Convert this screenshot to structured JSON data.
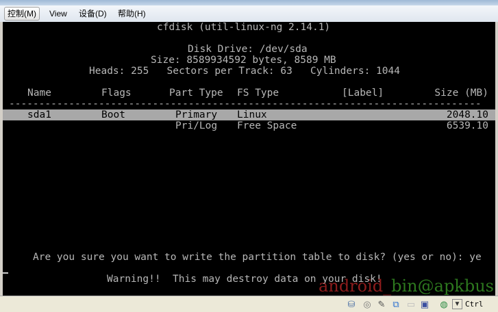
{
  "menu": [
    "控制(M)",
    "View",
    "设备(D)",
    "帮助(H)"
  ],
  "terminal": {
    "title": "cfdisk (util-linux-ng 2.14.1)",
    "disk_drive": "Disk Drive: /dev/sda",
    "size": "Size: 8589934592 bytes, 8589 MB",
    "geometry": "Heads: 255   Sectors per Track: 63   Cylinders: 1044",
    "headers": {
      "name": "Name",
      "flags": "Flags",
      "part_type": "Part Type",
      "fs_type": "FS Type",
      "label": "[Label]",
      "size": "Size (MB)"
    },
    "separator": "-------------------------------------------------------------------------------",
    "rows": [
      {
        "name": "sda1",
        "flags": "Boot",
        "part_type": "Primary",
        "fs_type": "Linux",
        "label": "",
        "size": "2048.10"
      },
      {
        "name": "",
        "flags": "",
        "part_type": "Pri/Log",
        "fs_type": "Free Space",
        "label": "",
        "size": "6539.10"
      }
    ],
    "prompt": "Are you sure you want to write the partition table to disk? (yes or no): ye",
    "warning": "Warning!!  This may destroy data on your disk!"
  },
  "status": {
    "host_key": "Ctrl"
  },
  "watermark": {
    "part1": "android_",
    "part2": "bin@apkbus"
  }
}
